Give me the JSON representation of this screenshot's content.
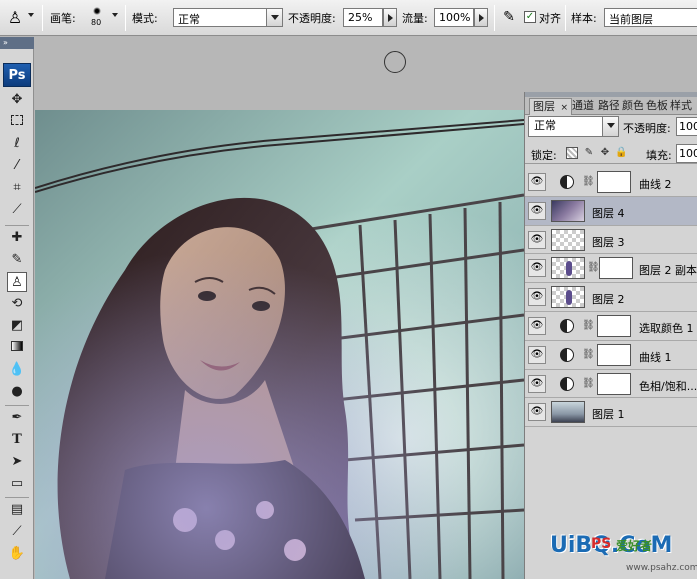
{
  "options_bar": {
    "brush_label": "画笔:",
    "brush_size": "80",
    "mode_label": "模式:",
    "mode_value": "正常",
    "opacity_label": "不透明度:",
    "opacity_value": "25%",
    "flow_label": "流量:",
    "flow_value": "100%",
    "aligned_label": "对齐",
    "aligned_checked": true,
    "sample_label": "样本:",
    "sample_value": "当前图层"
  },
  "toolbox": {
    "header": "»",
    "logo": "Ps",
    "active_tool": "clone-stamp"
  },
  "layers_panel": {
    "tabs": [
      {
        "label": "图层",
        "active": true
      },
      {
        "label": "通道"
      },
      {
        "label": "路径"
      },
      {
        "label": "颜色"
      },
      {
        "label": "色板"
      },
      {
        "label": "样式"
      }
    ],
    "tab_close": "×",
    "blend_mode": "正常",
    "opacity_label": "不透明度:",
    "opacity_value": "100",
    "lock_label": "锁定:",
    "fill_label": "填充:",
    "fill_value": "100",
    "layers": [
      {
        "name": "曲线 2",
        "type": "adjustment",
        "visible": true
      },
      {
        "name": "图层 4",
        "type": "pixel",
        "visible": true,
        "selected": true
      },
      {
        "name": "图层 3",
        "type": "empty",
        "visible": true
      },
      {
        "name": "图层 2 副本",
        "type": "masked",
        "visible": true
      },
      {
        "name": "图层 2",
        "type": "figure",
        "visible": true
      },
      {
        "name": "选取颜色 1",
        "type": "adjustment",
        "visible": true
      },
      {
        "name": "曲线 1",
        "type": "adjustment",
        "visible": true
      },
      {
        "name": "色相/饱和...",
        "type": "adjustment",
        "visible": true
      },
      {
        "name": "图层 1",
        "type": "photo",
        "visible": true
      }
    ]
  },
  "watermark": {
    "brand": "UiBQ.CoM",
    "ps": "PS",
    "cn": "爱好者",
    "url": "www.psahz.com"
  },
  "colors": {
    "selected_layer": "#b3b8c6",
    "ps_logo": "#1f5fb0",
    "watermark": "#1b6bb4"
  }
}
